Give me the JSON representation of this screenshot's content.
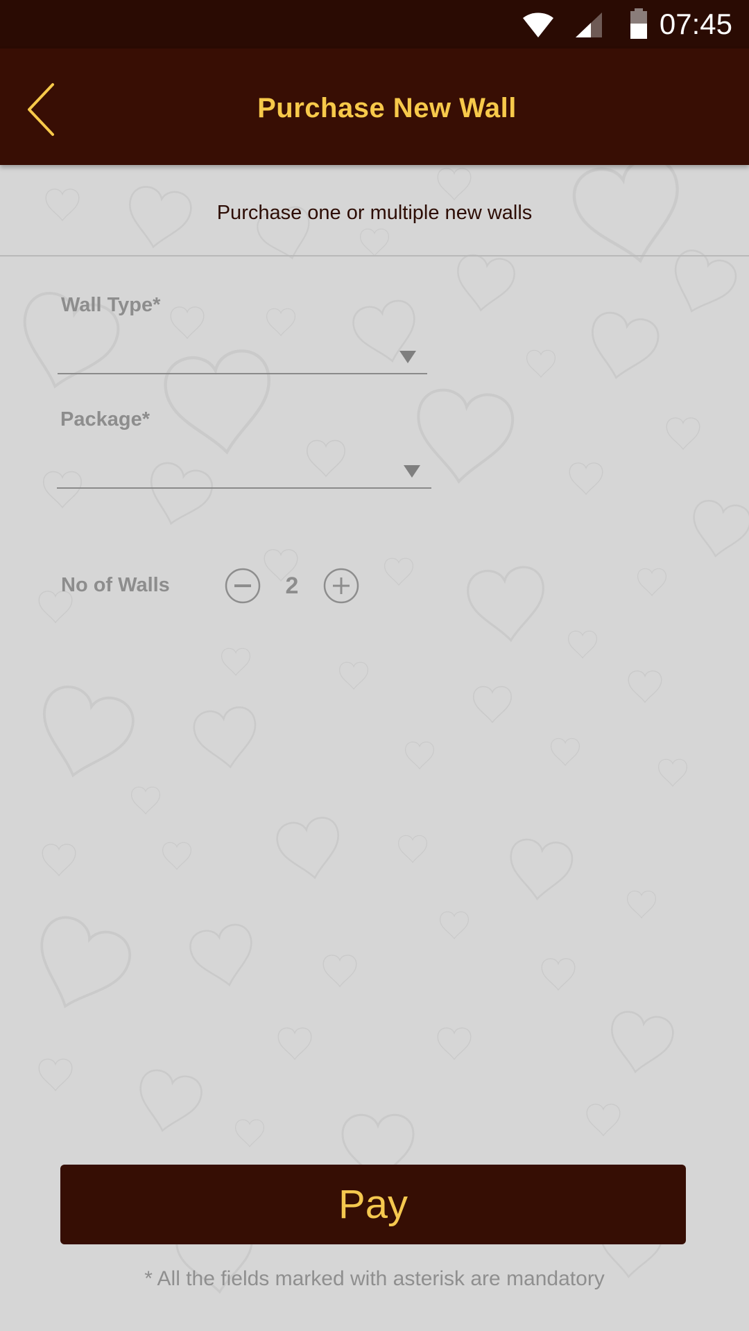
{
  "status_bar": {
    "time": "07:45",
    "icons": [
      "wifi-icon",
      "cell-signal-icon",
      "battery-icon"
    ]
  },
  "app_bar": {
    "title": "Purchase New Wall",
    "back_icon": "chevron-left-icon"
  },
  "form": {
    "subtitle": "Purchase one or multiple new walls",
    "wall_type": {
      "label": "Wall Type*",
      "value": ""
    },
    "package": {
      "label": "Package*",
      "value": ""
    },
    "walls": {
      "label": "No of Walls",
      "count": "2",
      "decrement_icon": "minus-circle-icon",
      "increment_icon": "plus-circle-icon"
    }
  },
  "actions": {
    "pay_label": "Pay",
    "footnote": "* All the fields marked with asterisk are mandatory"
  },
  "colors": {
    "status_bar_bg": "#2a0b03",
    "app_bar_bg": "#380e04",
    "accent": "#f7c94a",
    "page_bg": "#d6d6d6",
    "muted_text": "#8d8d8d"
  }
}
